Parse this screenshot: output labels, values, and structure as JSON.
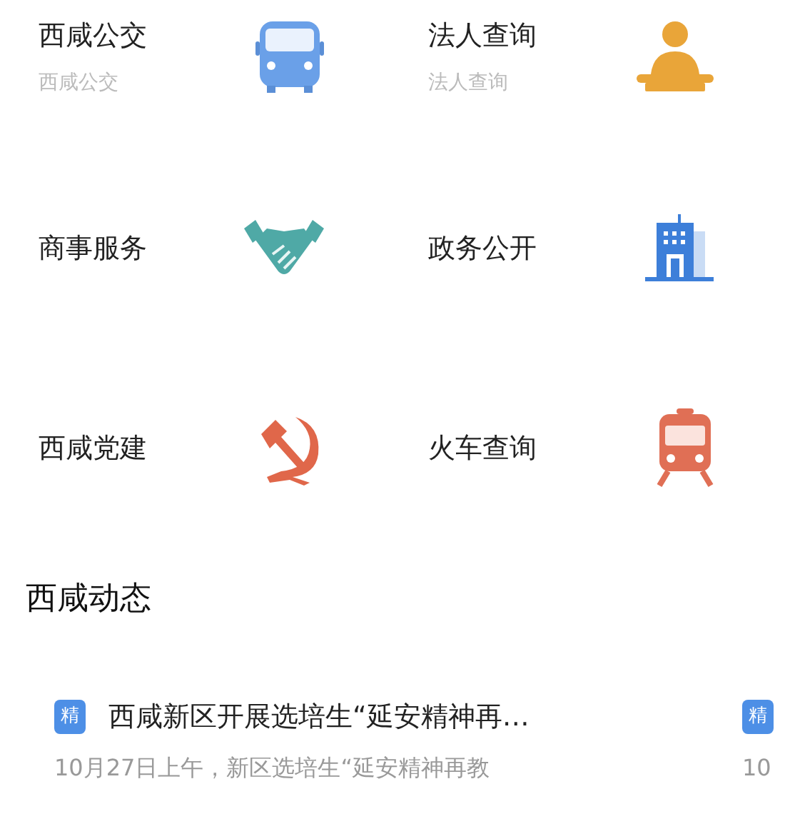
{
  "services": [
    {
      "title": "西咸公交",
      "subtitle": "西咸公交"
    },
    {
      "title": "法人查询",
      "subtitle": "法人查询"
    },
    {
      "title": "商事服务"
    },
    {
      "title": "政务公开"
    },
    {
      "title": "西咸党建"
    },
    {
      "title": "火车查询"
    }
  ],
  "news": {
    "heading": "西咸动态",
    "cards": [
      {
        "badge": "精",
        "title": "西咸新区开展选培生“延安精神再…",
        "summary": "10月27日上午，新区选培生“延安精神再教"
      },
      {
        "badge": "精",
        "summary": "10"
      }
    ]
  }
}
